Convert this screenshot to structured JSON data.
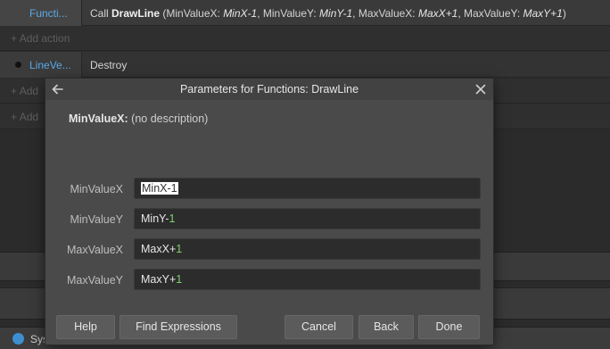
{
  "sheet": {
    "row1": {
      "object": "Functi...",
      "call_prefix": "Call",
      "function_name": "DrawLine",
      "args": [
        {
          "name": "MinValueX: ",
          "value": "MinX-1"
        },
        {
          "name": "MinValueY: ",
          "value": "MinY-1"
        },
        {
          "name": "MaxValueX: ",
          "value": "MaxX+1"
        },
        {
          "name": "MaxValueY: ",
          "value": "MaxY+1"
        }
      ]
    },
    "add_action": "Add action",
    "add_truncated": "Add",
    "row3": {
      "object": "LineVe...",
      "action": "Destroy"
    },
    "status_text": "Sys"
  },
  "dialog": {
    "title": "Parameters for Functions: DrawLine",
    "param_name": "MinValueX:",
    "param_desc": "(no description)",
    "params": [
      {
        "label": "MinValueX",
        "name": "MinX",
        "op": "-",
        "num": "1"
      },
      {
        "label": "MinValueY",
        "name": "MinY",
        "op": "-",
        "num": "1"
      },
      {
        "label": "MaxValueX",
        "name": "MaxX",
        "op": "+",
        "num": "1"
      },
      {
        "label": "MaxValueY",
        "name": "MaxY",
        "op": "+",
        "num": "1"
      }
    ],
    "buttons": {
      "help": "Help",
      "find": "Find Expressions",
      "cancel": "Cancel",
      "back": "Back",
      "done": "Done"
    }
  }
}
